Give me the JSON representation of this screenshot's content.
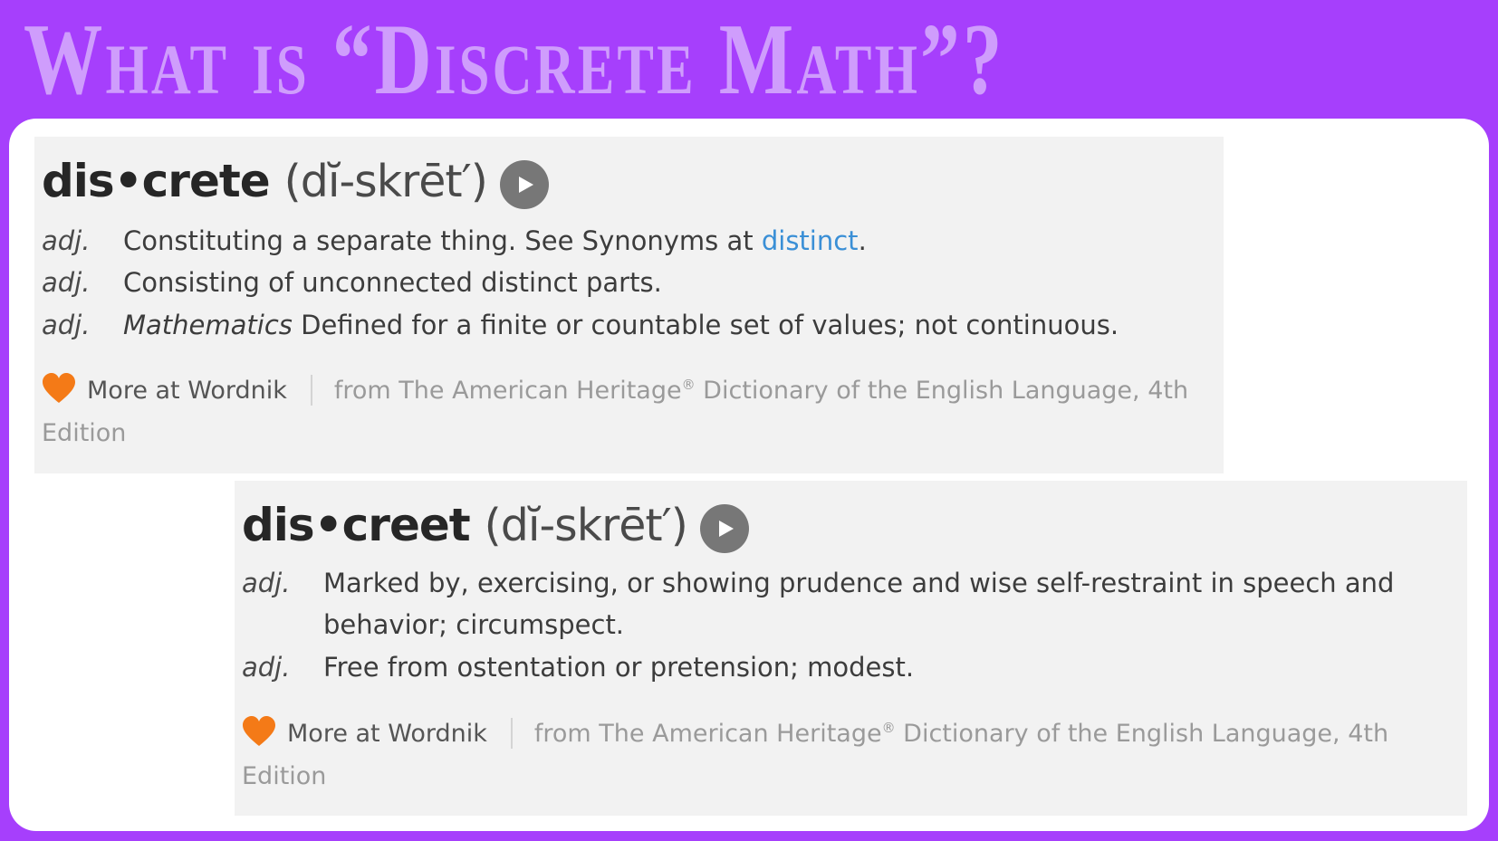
{
  "slide": {
    "title": "What is “Discrete Math”?",
    "accent_color": "#a63ffc",
    "title_color": "#cf9dfc"
  },
  "entries": [
    {
      "headword": "dis•crete",
      "pronunciation": "(dĭ-skrēt′)",
      "play_icon": "play-icon",
      "senses": [
        {
          "pos": "adj.",
          "text_before": "Constituting a separate thing. See Synonyms at ",
          "link": "distinct",
          "text_after": "."
        },
        {
          "pos": "adj.",
          "text": "Consisting of unconnected distinct parts."
        },
        {
          "pos": "adj.",
          "domain": "Mathematics",
          "text": " Defined for a finite or countable set of values; not continuous."
        }
      ],
      "source": {
        "heart_icon": "heart-icon",
        "more_label": "More at Wordnik",
        "from_label_1": "from The American Heritage",
        "registered": "®",
        "from_label_2": " Dictionary of the English Language, 4th Edition"
      }
    },
    {
      "headword": "dis•creet",
      "pronunciation": "(dĭ-skrēt′)",
      "play_icon": "play-icon",
      "senses": [
        {
          "pos": "adj.",
          "text": "Marked by, exercising, or showing prudence and wise self-restraint in speech and behavior; circumspect."
        },
        {
          "pos": "adj.",
          "text": "Free from ostentation or pretension; modest."
        }
      ],
      "source": {
        "heart_icon": "heart-icon",
        "more_label": "More at Wordnik",
        "from_label_1": "from The American Heritage",
        "registered": "®",
        "from_label_2": " Dictionary of the English Language, 4th Edition"
      }
    }
  ]
}
